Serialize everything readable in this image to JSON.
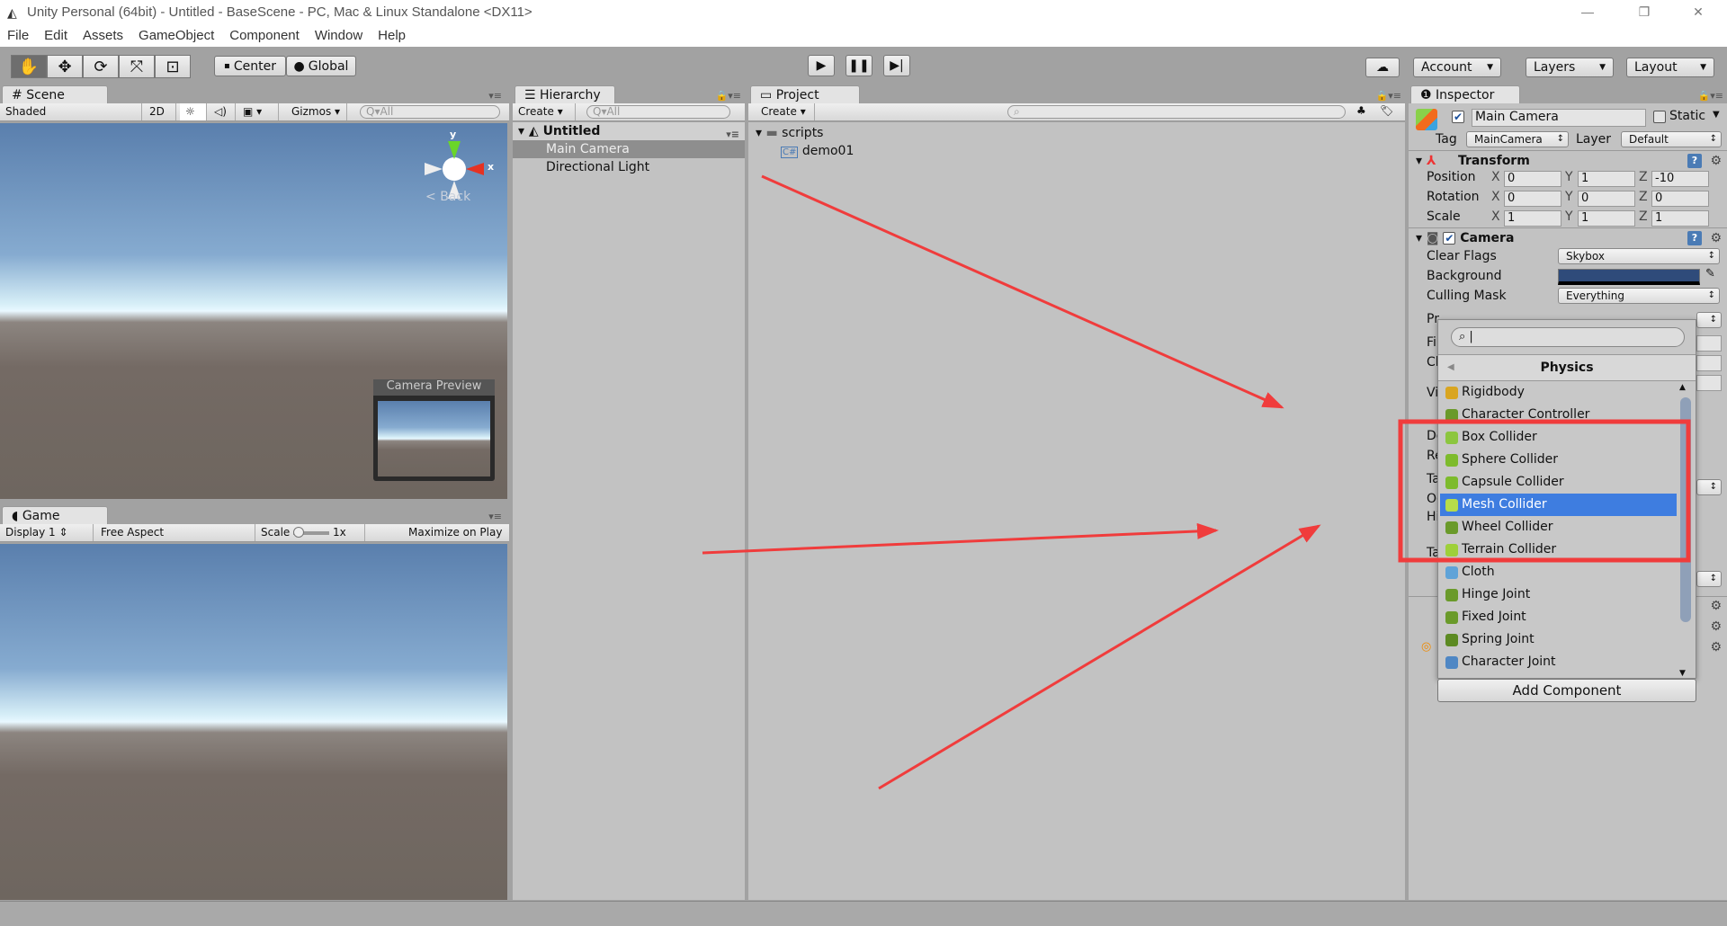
{
  "window": {
    "title": "Unity Personal (64bit) - Untitled - BaseScene - PC, Mac & Linux Standalone <DX11>",
    "controls": [
      "—",
      "❐",
      "✕"
    ]
  },
  "menu": [
    "File",
    "Edit",
    "Assets",
    "GameObject",
    "Component",
    "Window",
    "Help"
  ],
  "toolbar": {
    "tools": [
      "hand-icon",
      "move-icon",
      "rotate-icon",
      "scale-icon",
      "rect-icon"
    ],
    "pivot": "Center",
    "space": "Global",
    "account": "Account",
    "layers": "Layers",
    "layout": "Layout"
  },
  "scene": {
    "tab": "Scene",
    "shading": "Shaded",
    "mode2d": "2D",
    "gizmos": "Gizmos",
    "search_placeholder": "All",
    "axis_y": "y",
    "axis_x": "x",
    "view_label": "Back",
    "camera_preview": "Camera Preview"
  },
  "game": {
    "tab": "Game",
    "display": "Display 1",
    "aspect": "Free Aspect",
    "scale_label": "Scale",
    "scale_value": "1x",
    "maximize": "Maximize on Play"
  },
  "hierarchy": {
    "tab": "Hierarchy",
    "create": "Create",
    "search_placeholder": "All",
    "scene_name": "Untitled",
    "items": [
      "Main Camera",
      "Directional Light"
    ]
  },
  "project": {
    "tab": "Project",
    "create": "Create",
    "folder": "scripts",
    "file": "demo01"
  },
  "inspector": {
    "tab": "Inspector",
    "object_name": "Main Camera",
    "active": true,
    "static_label": "Static",
    "tag_label": "Tag",
    "tag": "MainCamera",
    "layer_label": "Layer",
    "layer": "Default",
    "transform": {
      "title": "Transform",
      "rows": [
        {
          "label": "Position",
          "x": "0",
          "y": "1",
          "z": "-10"
        },
        {
          "label": "Rotation",
          "x": "0",
          "y": "0",
          "z": "0"
        },
        {
          "label": "Scale",
          "x": "1",
          "y": "1",
          "z": "1"
        }
      ]
    },
    "camera": {
      "title": "Camera",
      "clear_flags_label": "Clear Flags",
      "clear_flags": "Skybox",
      "background_label": "Background",
      "background_color": "#2f4b7a",
      "culling_label": "Culling Mask",
      "culling": "Everything",
      "hidden_labels": [
        "Pr",
        "Fi",
        "Cl",
        "Vi",
        "De",
        "Re",
        "Ta",
        "Oc",
        "Hi",
        "Ta"
      ]
    },
    "add_component": "Add Component"
  },
  "popup": {
    "search_value": "",
    "category": "Physics",
    "selected": "Mesh Collider",
    "items": [
      {
        "label": "Rigidbody",
        "color": "#d9a520"
      },
      {
        "label": "Character Controller",
        "color": "#6a9a2a"
      },
      {
        "label": "Box Collider",
        "color": "#8cc63f"
      },
      {
        "label": "Sphere Collider",
        "color": "#7dbb2c"
      },
      {
        "label": "Capsule Collider",
        "color": "#7dbb2c"
      },
      {
        "label": "Mesh Collider",
        "color": "#b6dc4a"
      },
      {
        "label": "Wheel Collider",
        "color": "#6a9a2a"
      },
      {
        "label": "Terrain Collider",
        "color": "#9ed03a"
      },
      {
        "label": "Cloth",
        "color": "#5fa3d8"
      },
      {
        "label": "Hinge Joint",
        "color": "#6a9a2a"
      },
      {
        "label": "Fixed Joint",
        "color": "#6a9a2a"
      },
      {
        "label": "Spring Joint",
        "color": "#5c8a22"
      },
      {
        "label": "Character Joint",
        "color": "#4f87c4"
      }
    ]
  },
  "annotation": {
    "color": "#f03c3c"
  }
}
